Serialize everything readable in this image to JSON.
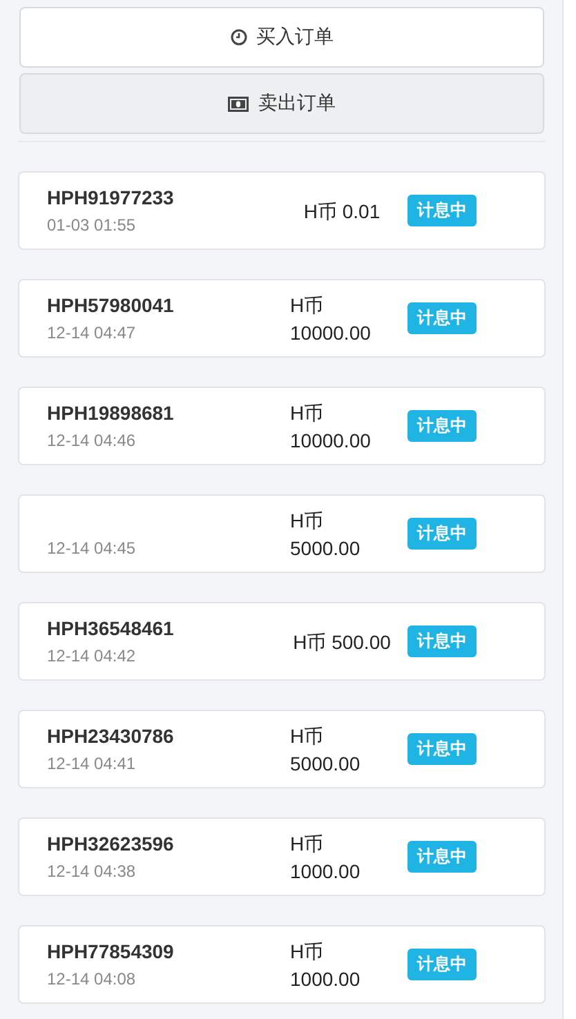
{
  "tabs": [
    {
      "label": "买入订单",
      "selected": false
    },
    {
      "label": "卖出订单",
      "selected": true
    }
  ],
  "orders": [
    {
      "id": "HPH91977233",
      "time": "01-03 01:55",
      "amount": "H币 0.01",
      "status": "计息中"
    },
    {
      "id": "HPH57980041",
      "time": "12-14 04:47",
      "amount": "H币 10000.00",
      "status": "计息中"
    },
    {
      "id": "HPH19898681",
      "time": "12-14 04:46",
      "amount": "H币 10000.00",
      "status": "计息中"
    },
    {
      "time": "12-14 04:45",
      "amount": "H币 5000.00",
      "status": "计息中"
    },
    {
      "id": "HPH36548461",
      "time": "12-14 04:42",
      "amount": "H币 500.00",
      "status": "计息中"
    },
    {
      "id": "HPH23430786",
      "time": "12-14 04:41",
      "amount": "H币 5000.00",
      "status": "计息中"
    },
    {
      "id": "HPH32623596",
      "time": "12-14 04:38",
      "amount": "H币 1000.00",
      "status": "计息中"
    },
    {
      "id": "HPH77854309",
      "time": "12-14 04:08",
      "amount": "H币 1000.00",
      "status": "计息中"
    }
  ]
}
